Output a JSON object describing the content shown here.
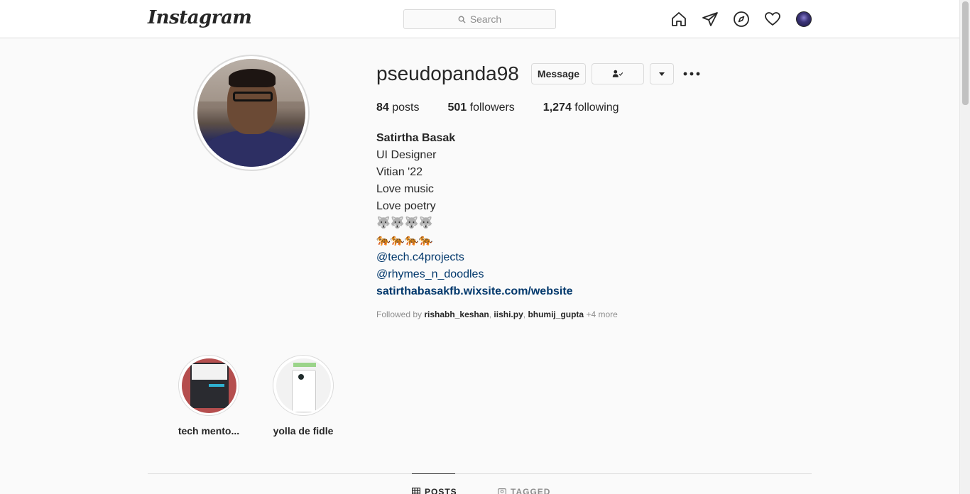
{
  "nav": {
    "logo": "Instagram",
    "search_placeholder": "Search",
    "icons": [
      "home-icon",
      "direct-icon",
      "explore-icon",
      "activity-heart-icon",
      "profile-avatar"
    ]
  },
  "profile": {
    "username": "pseudopanda98",
    "message_label": "Message",
    "stats": {
      "posts_count": "84",
      "posts_label": "posts",
      "followers_count": "501",
      "followers_label": "followers",
      "following_count": "1,274",
      "following_label": "following"
    },
    "bio": {
      "full_name": "Satirtha Basak",
      "line1": "UI Designer",
      "line2": "Vitian '22",
      "line3": "Love music",
      "line4": "Love poetry",
      "emoji_row1": "🐺🐺🐺🐺",
      "emoji_row2": "🐅🐅🐅🐅",
      "mention1": "@tech.c4projects",
      "mention2": "@rhymes_n_doodles",
      "website": "satirthabasakfb.wixsite.com/website"
    },
    "followed_by": {
      "prefix": "Followed by",
      "user1": "rishabh_keshan",
      "user2": "iishi.py",
      "user3": "bhumij_gupta",
      "more": "+4 more"
    }
  },
  "highlights": [
    {
      "label": "tech mento..."
    },
    {
      "label": "yolla de fidle"
    }
  ],
  "tabs": {
    "posts": "POSTS",
    "tagged": "TAGGED"
  },
  "colors": {
    "link": "#00376b",
    "border": "#dbdbdb",
    "text": "#262626",
    "muted": "#8e8e8e"
  }
}
